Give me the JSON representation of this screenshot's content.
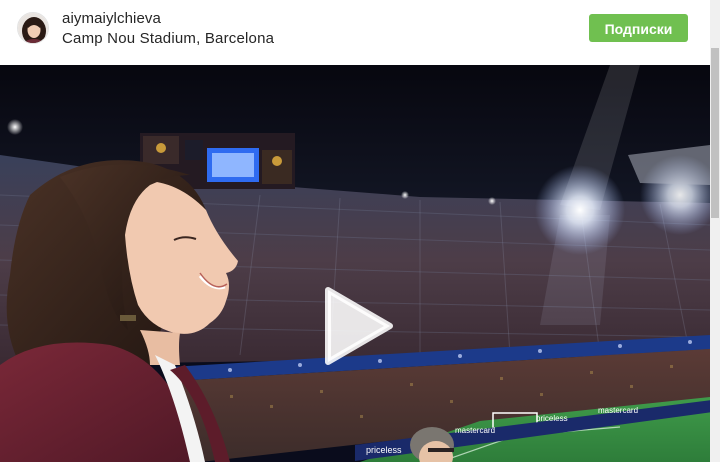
{
  "post": {
    "username": "aiymaiylchieva",
    "location": "Camp Nou Stadium, Barcelona",
    "follow_button_label": "Подписки"
  },
  "video": {
    "signboards": [
      "priceless",
      "mastercard",
      "priceless",
      "mastercard"
    ],
    "play_icon": "play-icon"
  },
  "colors": {
    "follow_button": "#70c050",
    "text": "#262626"
  }
}
